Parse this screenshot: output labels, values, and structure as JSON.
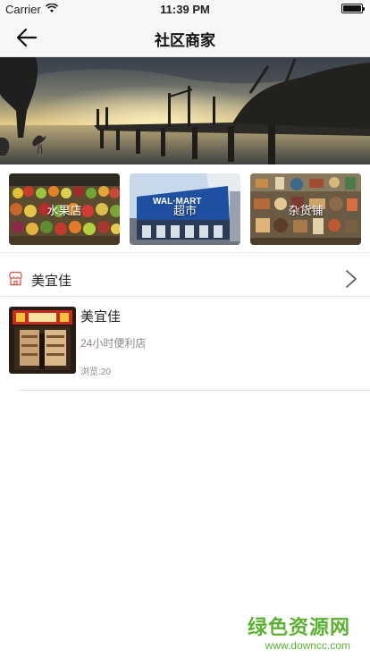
{
  "status_bar": {
    "carrier": "Carrier",
    "time": "11:39 PM",
    "battery_level": 1.0
  },
  "nav": {
    "title": "社区商家",
    "back_icon": "arrow-left-icon"
  },
  "categories": [
    {
      "label": "水果店"
    },
    {
      "label": "超市"
    },
    {
      "label": "杂货铺"
    }
  ],
  "store_section": {
    "title": "美宜佳",
    "icon": "store-icon",
    "chevron": "chevron-right-icon"
  },
  "stores": [
    {
      "name": "美宜佳",
      "description": "24小时便利店",
      "views": "浏览:20"
    }
  ],
  "watermark": {
    "text": "绿色资源网",
    "url": "www.downcc.com"
  },
  "colors": {
    "accent_red": "#e64b3c",
    "watermark_green": "#5bb230"
  }
}
